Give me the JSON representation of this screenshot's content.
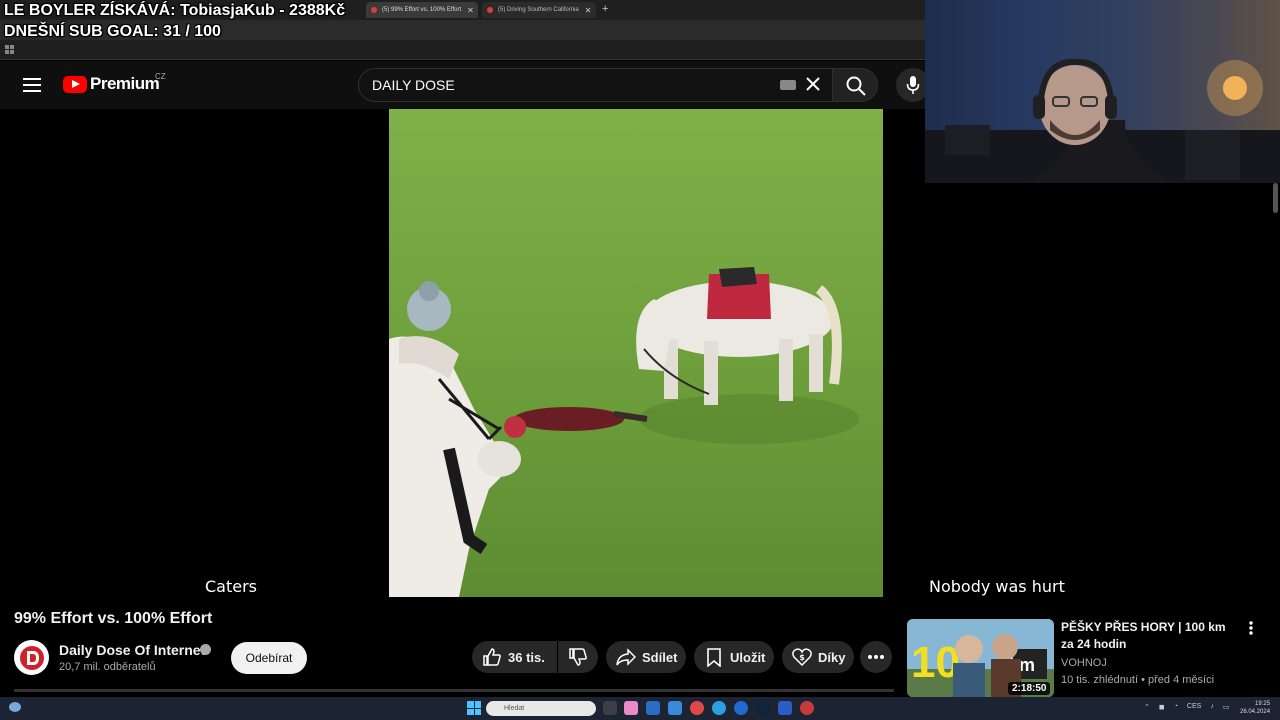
{
  "browser": {
    "tabs": [
      {
        "label": "(5) 99% Effort vs. 100% Effort",
        "active": true
      },
      {
        "label": "(5) Driving Southern California",
        "active": false
      }
    ]
  },
  "overlay": {
    "line1": "LE BOYLER ZÍSKÁVÁ: TobiasjaKub - 2388Kč",
    "line2": "DNEŠNÍ SUB GOAL: 31 / 100"
  },
  "header": {
    "logo_text": "Premium",
    "country_code": "CZ",
    "search_value": "DAILY DOSE"
  },
  "video": {
    "caption_left": "Caters",
    "caption_right": "Nobody was hurt"
  },
  "info": {
    "title": "99% Effort vs. 100% Effort",
    "channel_name": "Daily Dose Of Internet",
    "subscribers": "20,7 mil. odběratelů",
    "subscribe_label": "Odebírat",
    "likes": "36 tis.",
    "share_label": "Sdílet",
    "save_label": "Uložit",
    "thanks_label": "Díky"
  },
  "recommended": {
    "title": "PĚŠKY PŘES HORY | 100 km za 24 hodin",
    "channel": "VOHNOJ",
    "meta": "10 tis. zhlédnutí • před 4 měsíci",
    "duration": "2:18:50"
  },
  "taskbar": {
    "search_placeholder": "Hledat",
    "tray_lang": "CES",
    "time": "19:25",
    "date": "26.04.2024"
  },
  "colors": {
    "youtube_red": "#ff0000",
    "background": "#0f0f0f",
    "pill_bg": "#272727"
  }
}
